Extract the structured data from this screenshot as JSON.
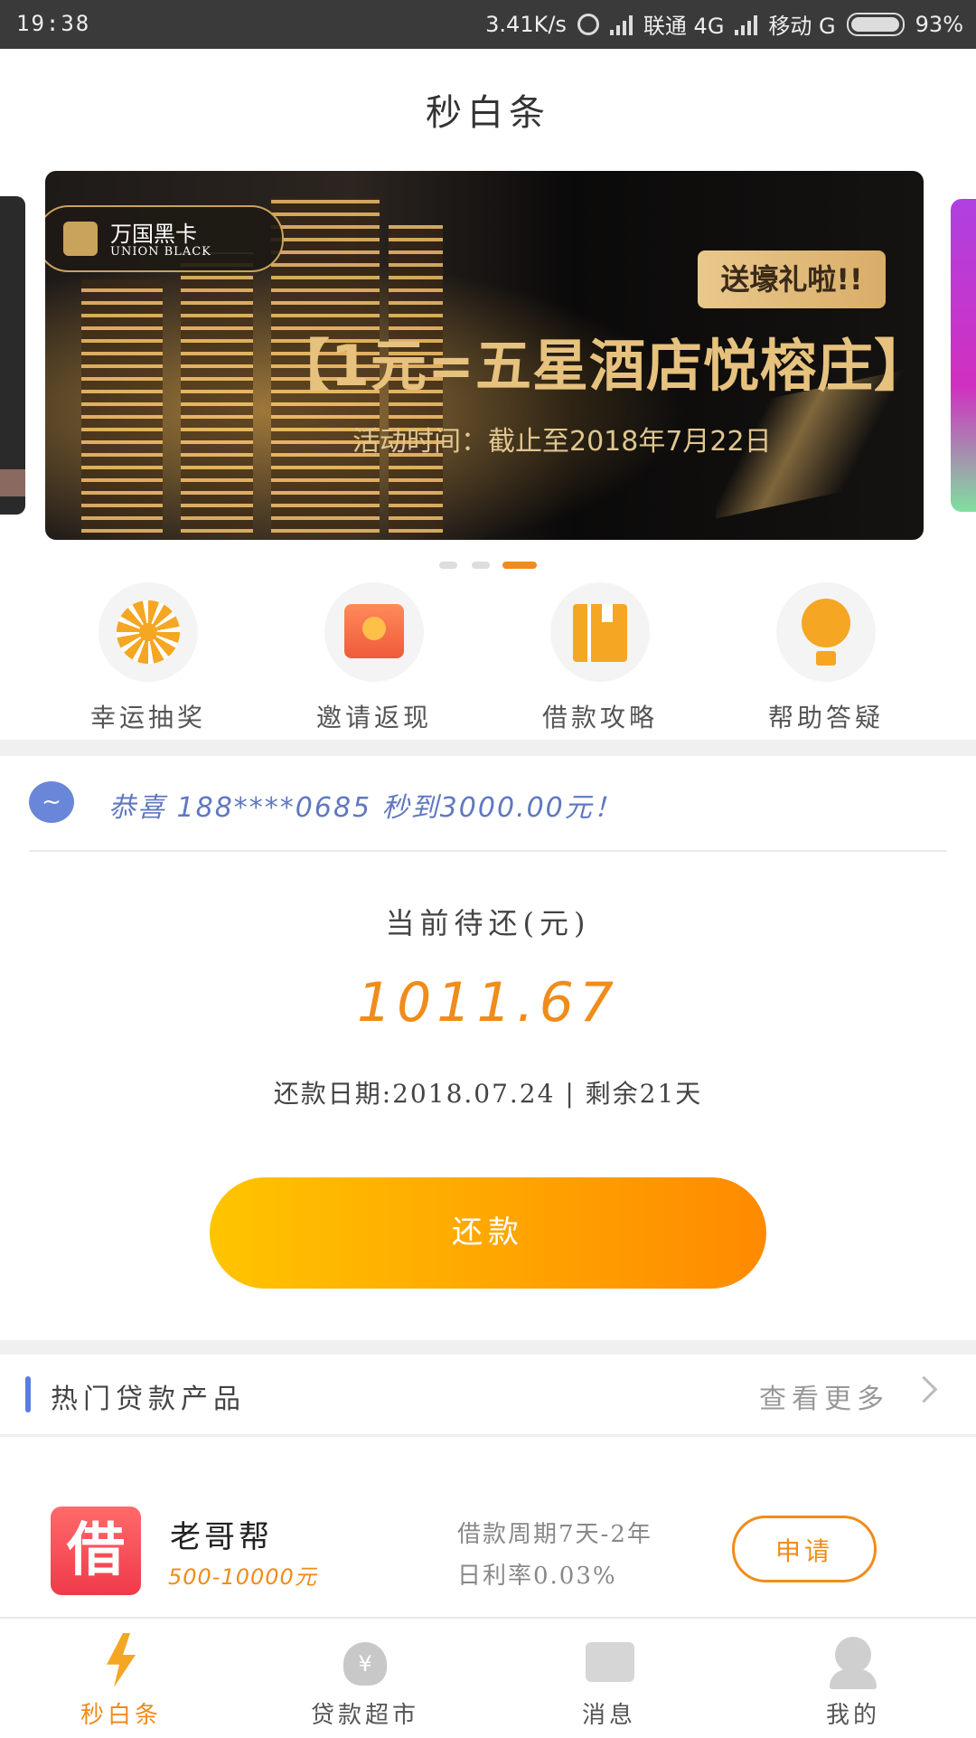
{
  "status_bar": {
    "time": "19:38",
    "net_speed": "3.41K/s",
    "carrier1": "联通 4G",
    "carrier2": "移动 G",
    "battery": "93%"
  },
  "header": {
    "title": "秒白条"
  },
  "banner": {
    "logo_cn": "万国黑卡",
    "logo_en": "UNION BLACK",
    "badge": "送壕礼啦!!",
    "headline": "【1元=五星酒店悦榕庄】",
    "subtitle": "活动时间：截止至2018年7月22日",
    "active_dot": 3,
    "dot_count": 3
  },
  "quick_actions": [
    {
      "label": "幸运抽奖",
      "icon": "lucky-wheel-icon"
    },
    {
      "label": "邀请返现",
      "icon": "red-envelope-icon"
    },
    {
      "label": "借款攻略",
      "icon": "book-icon"
    },
    {
      "label": "帮助答疑",
      "icon": "lightbulb-icon"
    }
  ],
  "notice": {
    "text": "恭喜 188****0685 秒到3000.00元！"
  },
  "repayment": {
    "label": "当前待还(元)",
    "amount": "1011.67",
    "info": "还款日期:2018.07.24 | 剩余21天",
    "button": "还款"
  },
  "hot_products": {
    "title": "热门贷款产品",
    "more": "查看更多",
    "items": [
      {
        "logo_char": "借",
        "name": "老哥帮",
        "range": "500-10000元",
        "term": "借款周期7天-2年",
        "rate": "日利率0.03%",
        "button": "申请"
      }
    ]
  },
  "tabbar": {
    "items": [
      {
        "label": "秒白条",
        "icon": "lightning-icon",
        "active": true
      },
      {
        "label": "贷款超市",
        "icon": "money-bag-icon",
        "active": false
      },
      {
        "label": "消息",
        "icon": "mail-icon",
        "active": false
      },
      {
        "label": "我的",
        "icon": "person-icon",
        "active": false
      }
    ]
  },
  "colors": {
    "accent": "#f08c1a",
    "notice_blue": "#6078c0",
    "button_start": "#ffc400",
    "button_end": "#ff8a00"
  }
}
